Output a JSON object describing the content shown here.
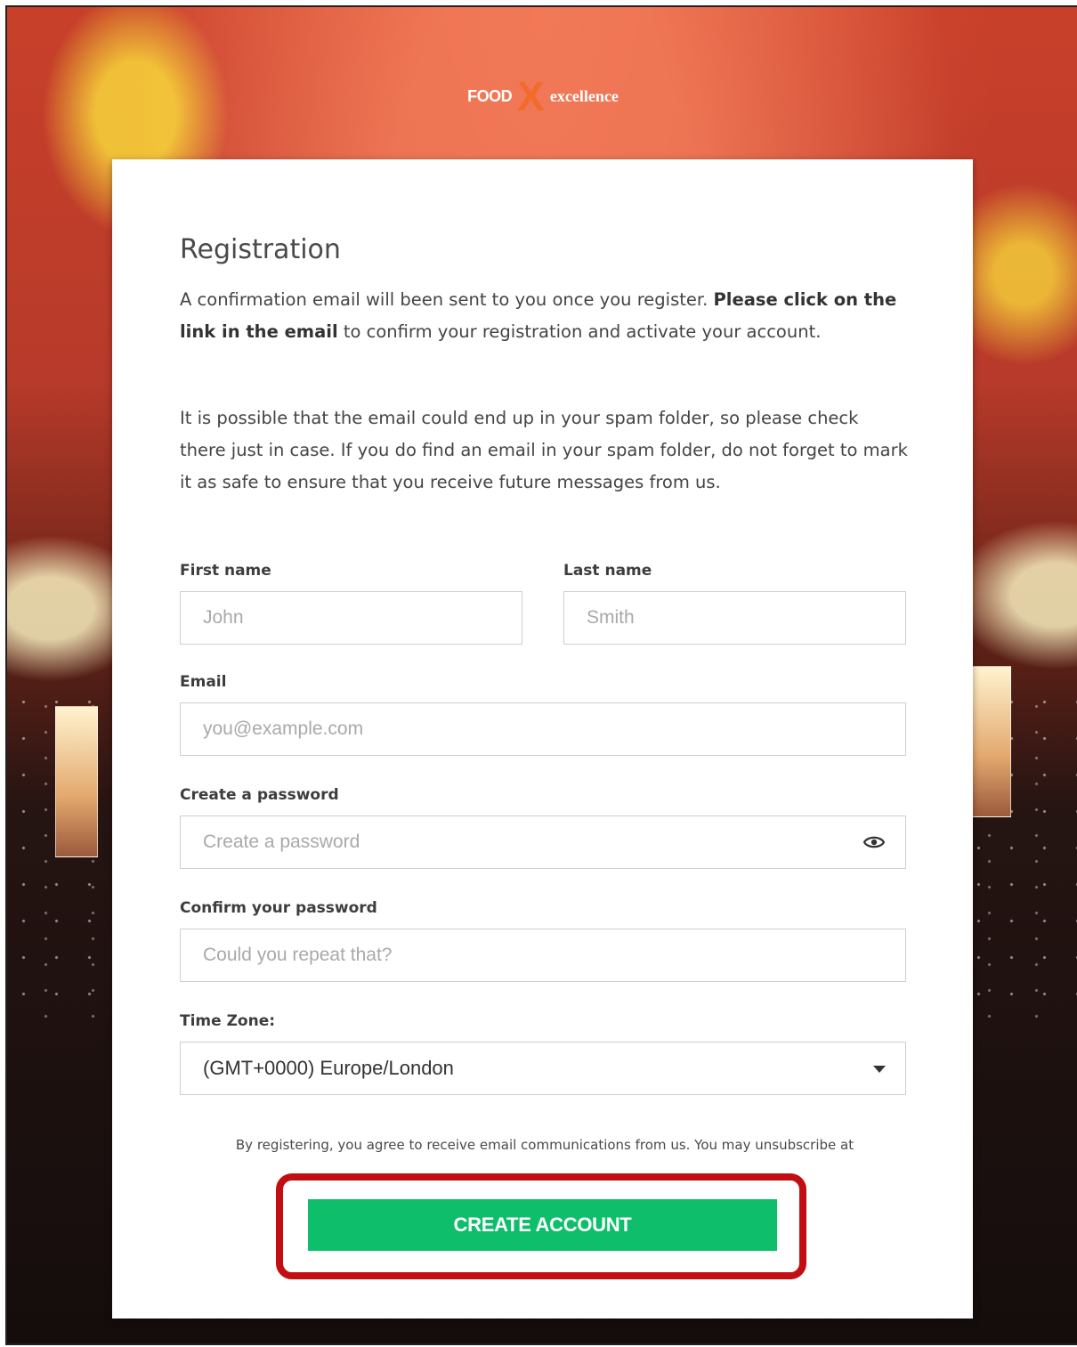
{
  "logo": {
    "food": "FOOD",
    "x": "X",
    "excellence": "excellence"
  },
  "form": {
    "title": "Registration",
    "intro_part1": "A confirmation email will been sent to you once you register. ",
    "intro_bold": "Please click on the link in the email",
    "intro_part2": " to confirm your registration and activate your account.",
    "spam_note": "It is possible that the email could end up in your spam folder, so please check there just in case. If you do find an email in your spam folder, do not forget to mark it as safe to ensure that you receive future messages from us.",
    "first_name": {
      "label": "First name",
      "placeholder": "John"
    },
    "last_name": {
      "label": "Last name",
      "placeholder": "Smith"
    },
    "email": {
      "label": "Email",
      "placeholder": "you@example.com"
    },
    "password": {
      "label": "Create a password",
      "placeholder": "Create a password"
    },
    "confirm_password": {
      "label": "Confirm your password",
      "placeholder": "Could you repeat that?"
    },
    "time_zone": {
      "label": "Time Zone:",
      "value": "(GMT+0000) Europe/London"
    },
    "consent": "By registering, you agree to receive email communications from us. You may unsubscribe at",
    "submit_label": "CREATE ACCOUNT"
  },
  "colors": {
    "button": "#0fbe6b",
    "highlight": "#c20e12",
    "accent": "#f26b2a"
  }
}
